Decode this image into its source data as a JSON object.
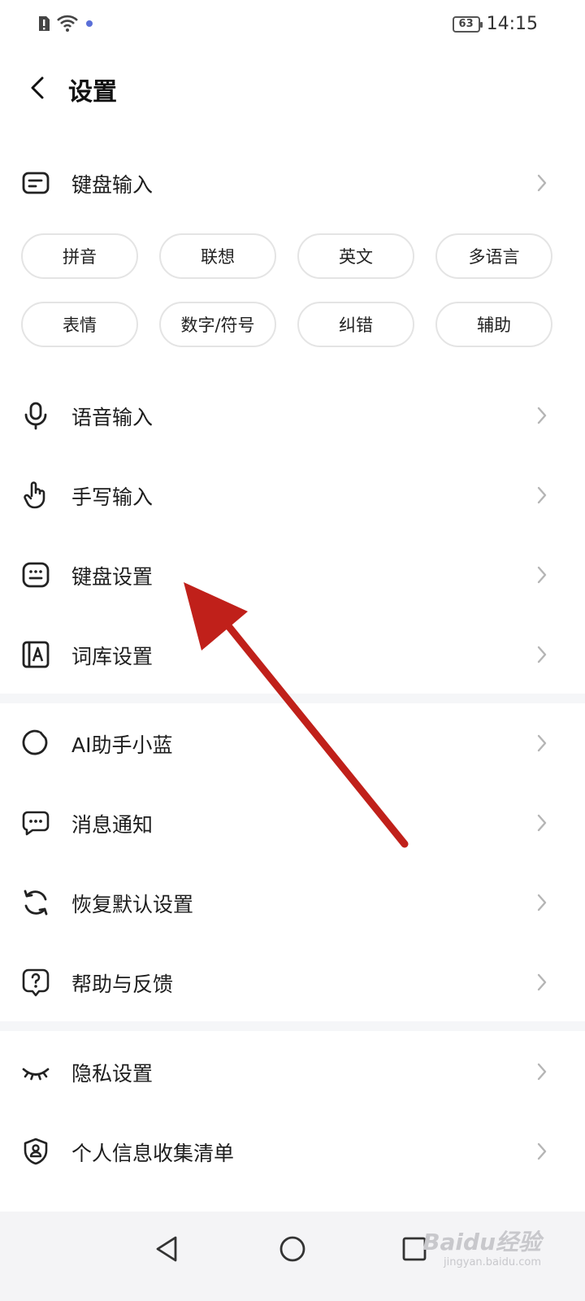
{
  "status_bar": {
    "time": "14:15",
    "battery": "63"
  },
  "header": {
    "title": "设置"
  },
  "keyboard_input": {
    "label": "键盘输入",
    "chips": [
      "拼音",
      "联想",
      "英文",
      "多语言",
      "表情",
      "数字/符号",
      "纠错",
      "辅助"
    ]
  },
  "group1": [
    {
      "label": "语音输入",
      "icon": "microphone-icon"
    },
    {
      "label": "手写输入",
      "icon": "hand-pointer-icon"
    },
    {
      "label": "键盘设置",
      "icon": "keyboard-icon"
    },
    {
      "label": "词库设置",
      "icon": "dictionary-icon"
    }
  ],
  "group2": [
    {
      "label": "AI助手小蓝",
      "icon": "ai-ring-icon"
    },
    {
      "label": "消息通知",
      "icon": "message-icon"
    },
    {
      "label": "恢复默认设置",
      "icon": "refresh-icon"
    },
    {
      "label": "帮助与反馈",
      "icon": "help-icon"
    }
  ],
  "group3": [
    {
      "label": "隐私设置",
      "icon": "eye-closed-icon"
    },
    {
      "label": "个人信息收集清单",
      "icon": "shield-user-icon"
    }
  ],
  "watermark": {
    "brand": "Baidu经验",
    "url": "jingyan.baidu.com"
  },
  "colors": {
    "annotation_arrow": "#c0201a",
    "divider": "#f5f6f8",
    "chip_border": "#e4e4e4"
  }
}
